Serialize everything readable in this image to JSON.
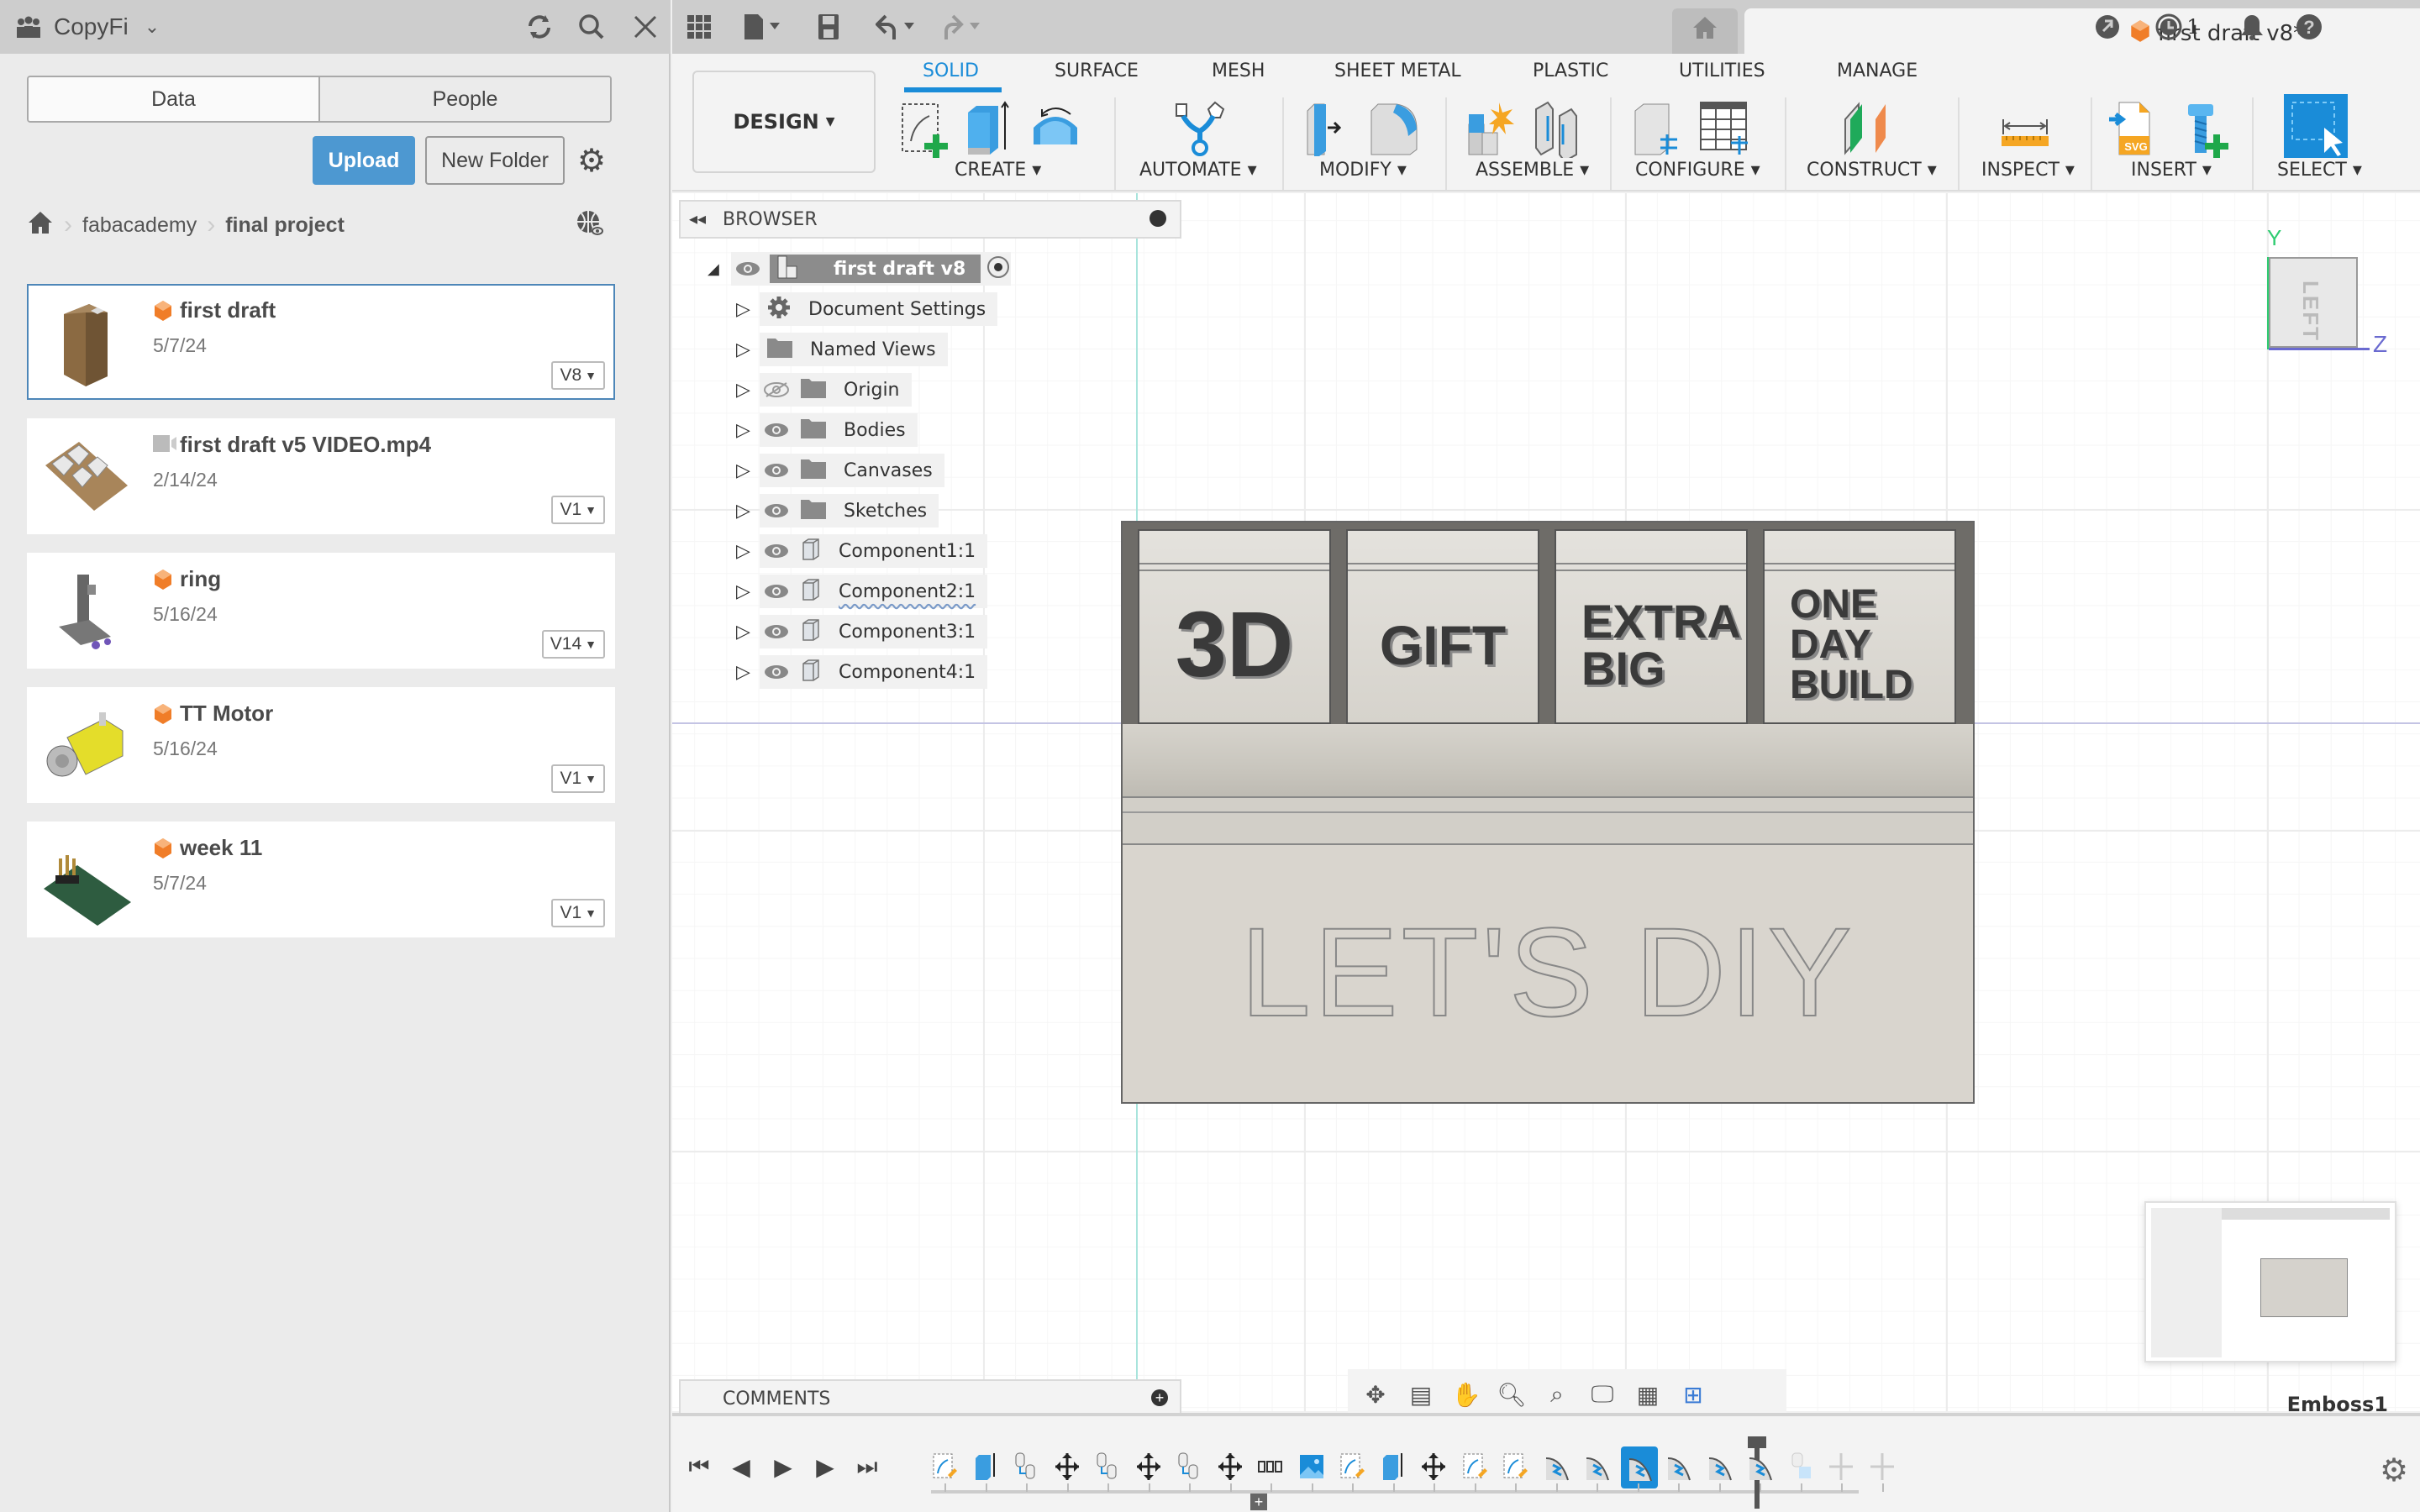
{
  "data_panel": {
    "app_name": "CopyFi",
    "tabs": [
      {
        "label": "Data",
        "active": true
      },
      {
        "label": "People",
        "active": false
      }
    ],
    "upload_label": "Upload",
    "new_folder_label": "New Folder",
    "breadcrumb": [
      {
        "label": "fabacademy"
      },
      {
        "label": "final project"
      }
    ],
    "files": [
      {
        "name": "first draft",
        "date": "5/7/24",
        "version": "V8",
        "type": "design",
        "selected": true
      },
      {
        "name": "first draft v5 VIDEO.mp4",
        "date": "2/14/24",
        "version": "V1",
        "type": "video",
        "selected": false
      },
      {
        "name": "ring",
        "date": "5/16/24",
        "version": "V14",
        "type": "design",
        "selected": false
      },
      {
        "name": "TT Motor",
        "date": "5/16/24",
        "version": "V1",
        "type": "design",
        "selected": false
      },
      {
        "name": "week 11",
        "date": "5/7/24",
        "version": "V1",
        "type": "design",
        "selected": false
      }
    ]
  },
  "topbar": {
    "document_tab": "first draft v8*",
    "job_count": "1"
  },
  "toolbar": {
    "workspace": "DESIGN",
    "tabs": [
      "SOLID",
      "SURFACE",
      "MESH",
      "SHEET METAL",
      "PLASTIC",
      "UTILITIES",
      "MANAGE"
    ],
    "active_tab": "SOLID",
    "groups": [
      "CREATE",
      "AUTOMATE",
      "MODIFY",
      "ASSEMBLE",
      "CONFIGURE",
      "CONSTRUCT",
      "INSPECT",
      "INSERT",
      "SELECT"
    ]
  },
  "browser": {
    "title": "BROWSER",
    "root": "first draft v8",
    "items": [
      {
        "label": "Document Settings",
        "icon": "gear-icon",
        "visible": null
      },
      {
        "label": "Named Views",
        "icon": "folder-icon",
        "visible": null
      },
      {
        "label": "Origin",
        "icon": "folder-icon",
        "visible": false
      },
      {
        "label": "Bodies",
        "icon": "folder-icon",
        "visible": true
      },
      {
        "label": "Canvases",
        "icon": "folder-icon",
        "visible": true
      },
      {
        "label": "Sketches",
        "icon": "folder-icon",
        "visible": true
      },
      {
        "label": "Component1:1",
        "icon": "component-icon",
        "visible": true
      },
      {
        "label": "Component2:1",
        "icon": "component-icon",
        "visible": true
      },
      {
        "label": "Component3:1",
        "icon": "component-icon",
        "visible": true
      },
      {
        "label": "Component4:1",
        "icon": "component-icon",
        "visible": true
      }
    ]
  },
  "viewport": {
    "model_labels": [
      "3D",
      "GIFT",
      "EXTRA BIG",
      "ONE DAY BUILD"
    ],
    "model_front_text": "LET'S DIY",
    "viewcube_face": "LEFT",
    "axis_y": "Y",
    "axis_z": "Z",
    "status_feature": "Emboss1"
  },
  "comments": {
    "title": "COMMENTS"
  },
  "colors": {
    "accent": "#1a8cd8",
    "upload": "#4d98d1",
    "brand_cube": "#f07d28"
  }
}
